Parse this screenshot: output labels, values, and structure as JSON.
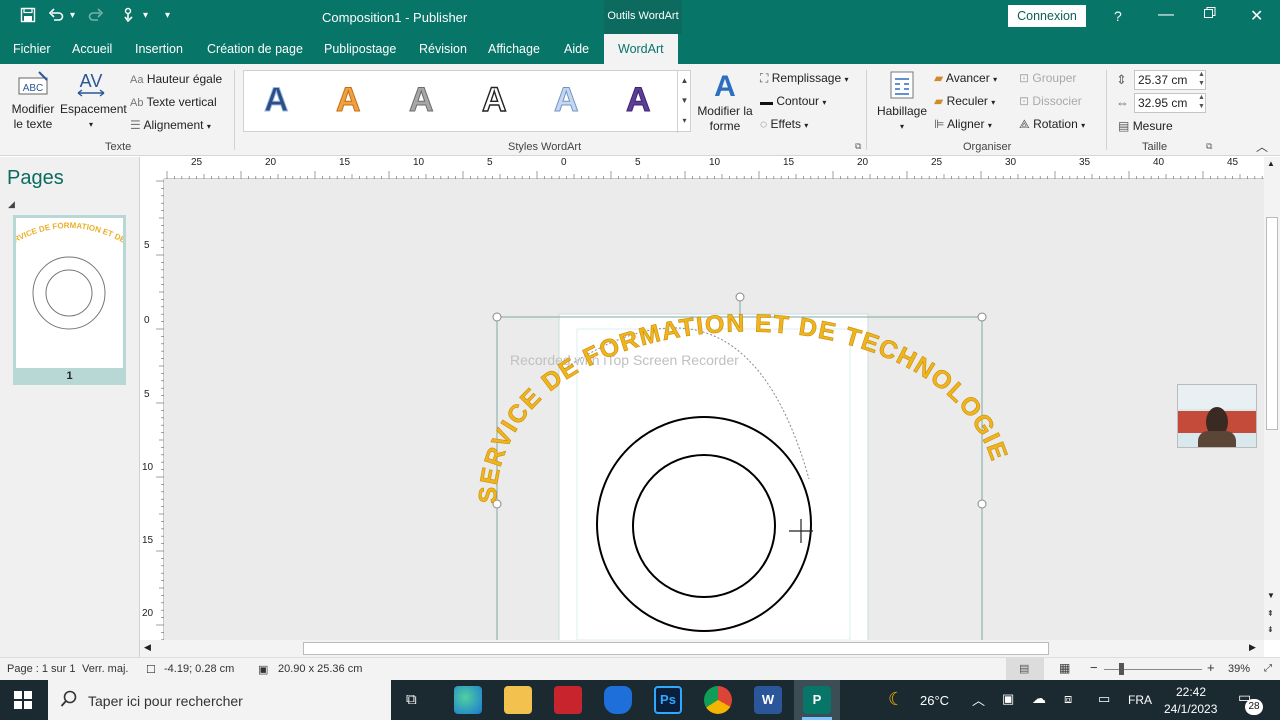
{
  "titlebar": {
    "title": "Composition1  -  Publisher",
    "context_tab": "Outils WordArt",
    "login": "Connexion",
    "help": "?"
  },
  "tabs": [
    "Fichier",
    "Accueil",
    "Insertion",
    "Création de page",
    "Publipostage",
    "Révision",
    "Affichage",
    "Aide",
    "WordArt"
  ],
  "ribbon": {
    "texte": {
      "modifier": [
        "Modifier",
        "le texte"
      ],
      "espacement": "Espacement",
      "hauteur": "Hauteur égale",
      "vertical": "Texte vertical",
      "alignement": "Alignement",
      "label": "Texte"
    },
    "styles": {
      "label": "Styles WordArt"
    },
    "forme": {
      "modifier": [
        "Modifier la",
        "forme"
      ],
      "remplissage": "Remplissage",
      "contour": "Contour",
      "effets": "Effets"
    },
    "organiser": {
      "habillage": "Habillage",
      "avancer": "Avancer",
      "reculer": "Reculer",
      "aligner": "Aligner",
      "grouper": "Grouper",
      "dissocier": "Dissocier",
      "rotation": "Rotation",
      "label": "Organiser"
    },
    "taille": {
      "height": "25.37 cm",
      "width": "32.95 cm",
      "mesure": "Mesure",
      "label": "Taille"
    }
  },
  "pages": {
    "title": "Pages",
    "page_number": "1"
  },
  "ruler": {
    "h_labels": [
      "25",
      "20",
      "15",
      "10",
      "5",
      "0",
      "5",
      "10",
      "15",
      "20",
      "25",
      "30",
      "35",
      "40",
      "45"
    ],
    "v_labels": [
      "5",
      "0",
      "5",
      "10",
      "15",
      "20"
    ]
  },
  "document": {
    "wordart": "SERVICE DE FORMATION ET DE TECHNOLOGIE",
    "watermark": "Recorded with iTop Screen Recorder",
    "wordart_color": "#f0b41c"
  },
  "status": {
    "page": "Page : 1 sur 1",
    "caps": "Verr. maj.",
    "position": "-4.19; 0.28  cm",
    "size": "20.90 x 25.36  cm",
    "zoom": "39%"
  },
  "taskbar": {
    "search": "Taper ici pour rechercher",
    "temperature": "26°C",
    "language": "FRA",
    "time": "22:42",
    "date": "24/1/2023",
    "notifications": "28"
  }
}
